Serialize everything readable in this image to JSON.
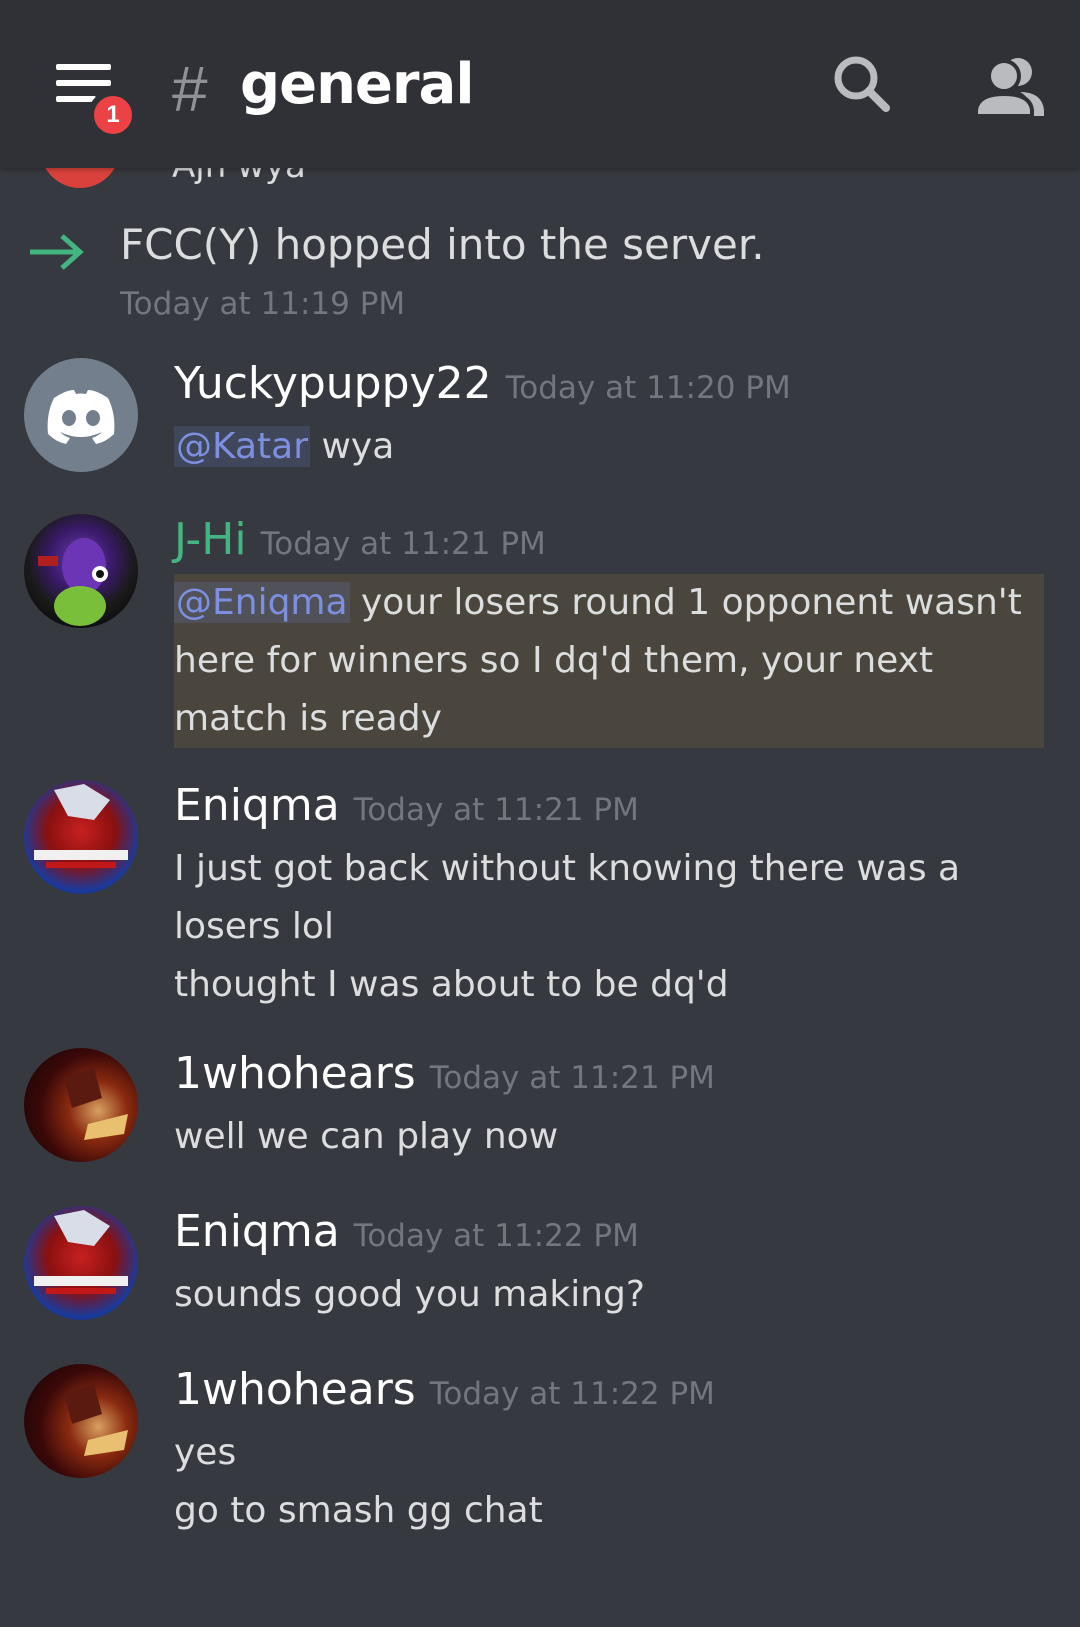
{
  "header": {
    "channel_hash": "#",
    "channel_name": "general",
    "notification_count": "1"
  },
  "cut_message": {
    "text": "Ajh wya"
  },
  "system_join": {
    "text": "FCC(Y) hopped into the server.",
    "timestamp": "Today at 11:19 PM"
  },
  "messages": [
    {
      "author": "Yuckypuppy22",
      "timestamp": "Today at 11:20 PM",
      "mention": "@Katar",
      "text": " wya"
    },
    {
      "author": "J-Hi",
      "author_color": "#43b581",
      "timestamp": "Today at 11:21 PM",
      "mention": "@Eniqma",
      "text": " your losers round 1 opponent wasn't here for winners so I dq'd them, your next match is ready"
    },
    {
      "author": "Eniqma",
      "timestamp": "Today at 11:21 PM",
      "line1": "I just got back without knowing there was a losers lol",
      "line2": "thought I was about to be dq'd"
    },
    {
      "author": "1whohears",
      "timestamp": "Today at 11:21 PM",
      "line1": "well we can play now"
    },
    {
      "author": "Eniqma",
      "timestamp": "Today at 11:22 PM",
      "line1": "sounds good you making?"
    },
    {
      "author": "1whohears",
      "timestamp": "Today at 11:22 PM",
      "line1": "yes",
      "line2": "go to smash gg chat"
    }
  ],
  "colors": {
    "background": "#36393f",
    "header": "#2f3136",
    "mention": "#7d8fe0",
    "join_arrow": "#43b581",
    "badge": "#ed4245"
  }
}
